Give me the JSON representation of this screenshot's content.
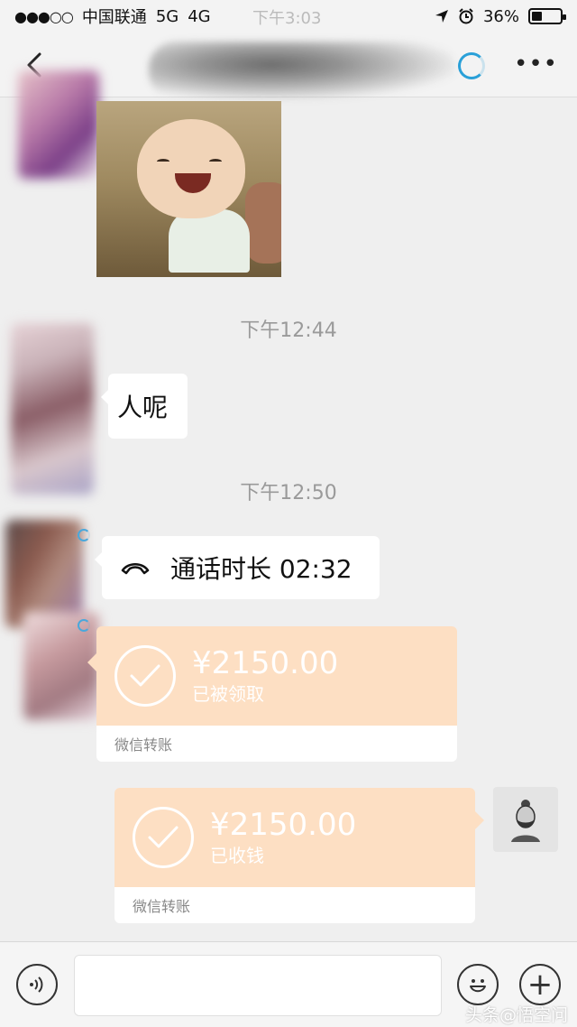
{
  "status_bar": {
    "signal": "●●●○○",
    "carrier": "中国联通",
    "network_5g": "5G",
    "network_4g": "4G",
    "time": "下午3:03",
    "battery_percent": "36%",
    "battery_level": 0.36
  },
  "nav": {
    "more_label": "•••"
  },
  "messages": {
    "time_1": "下午12:44",
    "text_1": "人呢",
    "time_2": "下午12:50",
    "call_text": "通话时长 02:32"
  },
  "transfer_received": {
    "amount": "¥2150.00",
    "status": "已被领取",
    "label": "微信转账"
  },
  "transfer_sent": {
    "amount": "¥2150.00",
    "status": "已收钱",
    "label": "微信转账"
  },
  "input_bar": {
    "plus_label": "+"
  },
  "watermark": {
    "text": "头条@悟空问答"
  },
  "colors": {
    "transfer_bg": "#fddfc3",
    "accent_blue": "#2aa0d8",
    "time_gray": "#9a9a9a"
  }
}
